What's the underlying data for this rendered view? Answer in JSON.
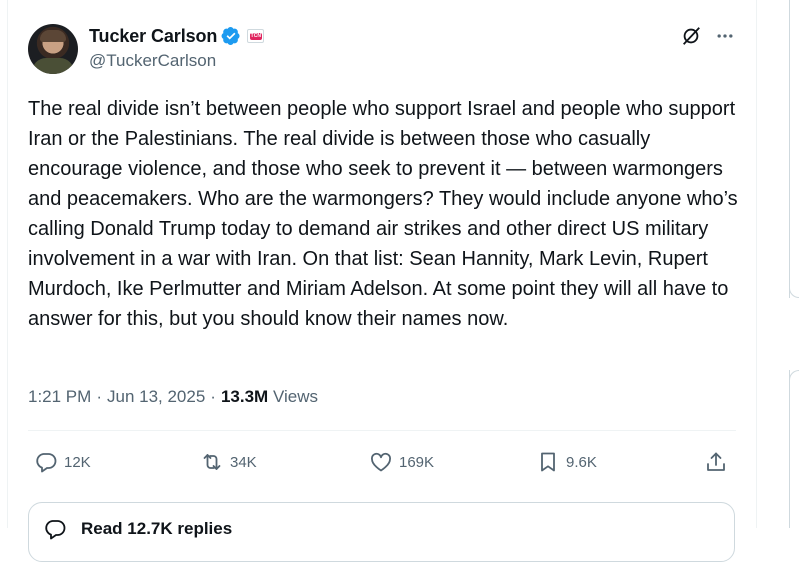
{
  "author": {
    "name": "Tucker Carlson",
    "handle": "@TuckerCarlson",
    "affiliate_badge": "TCN"
  },
  "tweet": {
    "text": "The real divide isn’t between people who support Israel and people who support Iran or the Palestinians. The real divide is between those who casually encourage violence, and those who seek to prevent it — between warmongers and peacemakers. Who are the warmongers? They would include anyone who’s calling Donald Trump today to demand air strikes and other direct US military involvement in a war with Iran. On that list: Sean Hannity, Mark Levin, Rupert Murdoch, Ike Perlmutter and Miriam Adelson. At some point they will all have to answer for this, but you should know their names now.",
    "time": "1:21 PM",
    "separator": "·",
    "date": "Jun 13, 2025",
    "views_count": "13.3M",
    "views_label": "Views"
  },
  "actions": {
    "replies": "12K",
    "reposts": "34K",
    "likes": "169K",
    "bookmarks": "9.6K"
  },
  "replies_prompt": "Read 12.7K replies",
  "icons": [
    "verified-badge-icon",
    "grok-icon",
    "more-icon",
    "reply-icon",
    "repost-icon",
    "like-icon",
    "bookmark-icon",
    "share-icon"
  ],
  "colors": {
    "verified": "#1d9bf0",
    "secondary_text": "#536471",
    "affiliate": "#e0245e"
  }
}
